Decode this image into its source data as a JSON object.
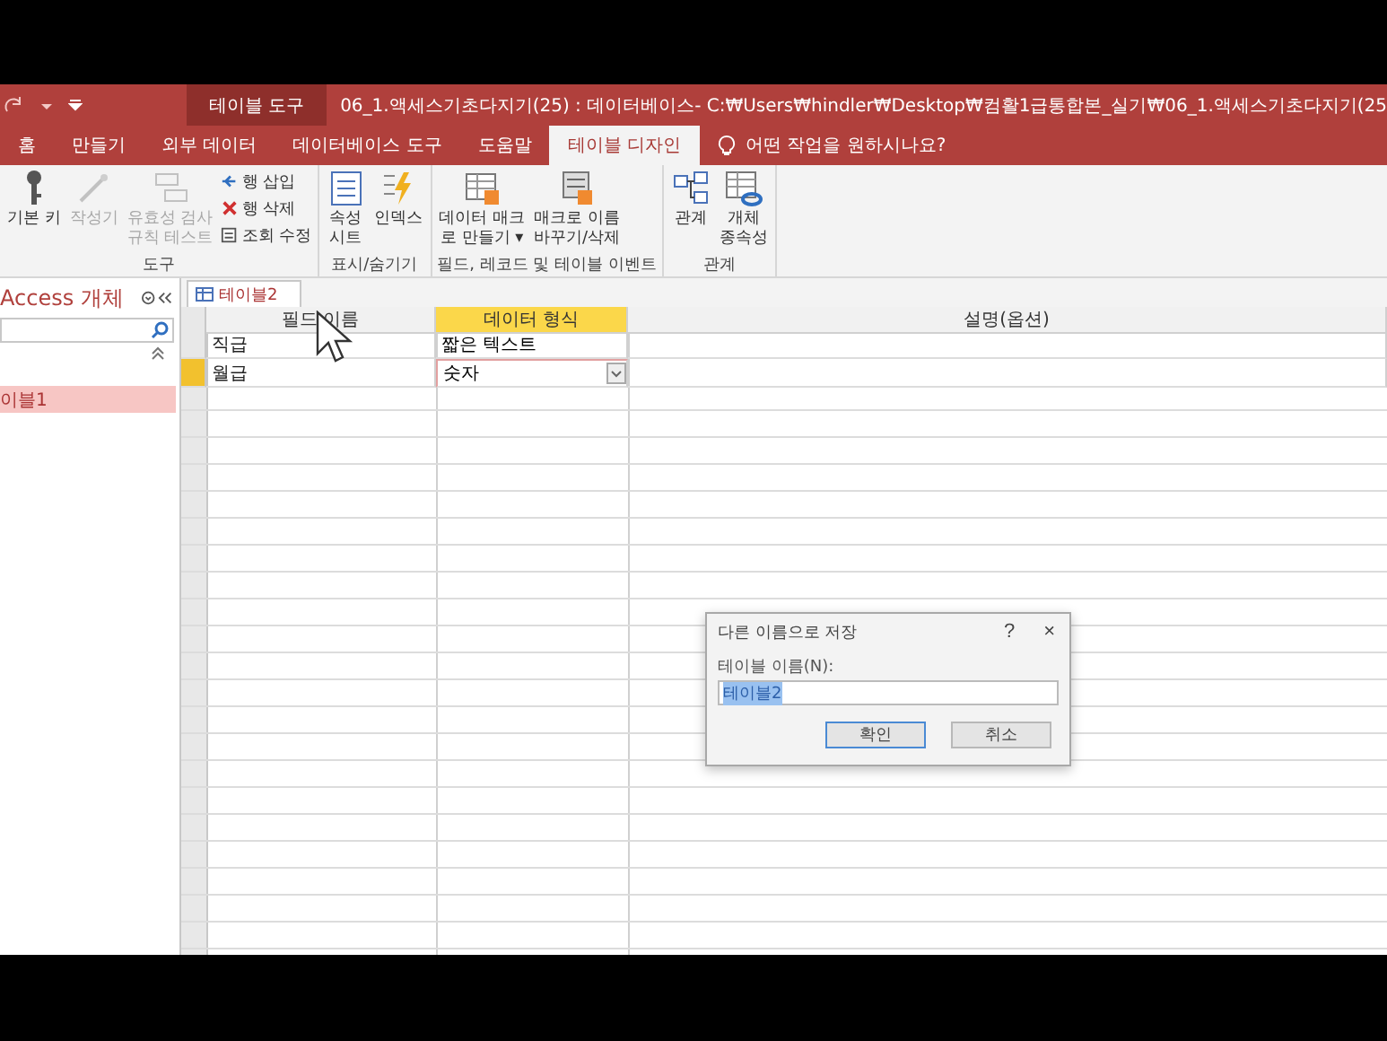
{
  "context_tab": {
    "label": "테이블 도구"
  },
  "window_title": "06_1.액세스기초다지기(25) : 데이터베이스- C:₩Users₩hindler₩Desktop₩컴활1급통합본_실기₩06_1.액세스기초다지기(25",
  "ribbon_tabs": [
    {
      "label": "홈",
      "selected": false
    },
    {
      "label": "만들기",
      "selected": false
    },
    {
      "label": "외부 데이터",
      "selected": false
    },
    {
      "label": "데이터베이스 도구",
      "selected": false
    },
    {
      "label": "도움말",
      "selected": false
    },
    {
      "label": "테이블 디자인",
      "selected": true
    }
  ],
  "tell_me": "어떤 작업을 원하시나요?",
  "ribbon_groups": [
    {
      "label": "도구",
      "buttons": [
        {
          "kind": "large",
          "label": "기본 키",
          "disabled": false
        },
        {
          "kind": "large",
          "label": "작성기",
          "disabled": true
        },
        {
          "kind": "large",
          "label": "유효성 검사\n규칙 테스트",
          "disabled": true
        },
        {
          "kind": "small",
          "label": "행 삽입",
          "disabled": false
        },
        {
          "kind": "small",
          "label": "행 삭제",
          "disabled": false
        },
        {
          "kind": "small",
          "label": "조회 수정",
          "disabled": false
        }
      ]
    },
    {
      "label": "표시/숨기기",
      "buttons": [
        {
          "kind": "large",
          "label": "속성\n시트",
          "disabled": false
        },
        {
          "kind": "large",
          "label": "인덱스",
          "disabled": false
        }
      ]
    },
    {
      "label": "필드, 레코드 및 테이블 이벤트",
      "buttons": [
        {
          "kind": "large",
          "label": "데이터 매크\n로 만들기 ▾",
          "disabled": false
        },
        {
          "kind": "large",
          "label": "매크로 이름\n바꾸기/삭제",
          "disabled": false
        }
      ]
    },
    {
      "label": "관계",
      "buttons": [
        {
          "kind": "large",
          "label": "관계",
          "disabled": false
        },
        {
          "kind": "large",
          "label": "개체\n종속성",
          "disabled": false
        }
      ]
    }
  ],
  "nav": {
    "title": "Access 개체",
    "items": [
      {
        "label": "이블1",
        "selected": true
      }
    ]
  },
  "doc_tab": {
    "label": "테이블2",
    "selected": true
  },
  "grid": {
    "columns": [
      {
        "label": "필드 이름",
        "selected": false
      },
      {
        "label": "데이터 형식",
        "selected": true
      },
      {
        "label": "설명(옵션)",
        "selected": false
      }
    ],
    "rows": [
      {
        "field": "직급",
        "type": "짧은 텍스트",
        "current": false
      },
      {
        "field": "월급",
        "type": "숫자",
        "current": true
      }
    ]
  },
  "dialog": {
    "title": "다른 이름으로 저장",
    "help": "?",
    "close": "×",
    "label": "테이블 이름(N):",
    "value": "테이블2",
    "buttons": [
      {
        "label": "확인",
        "focused": true
      },
      {
        "label": "취소",
        "focused": false
      }
    ]
  }
}
